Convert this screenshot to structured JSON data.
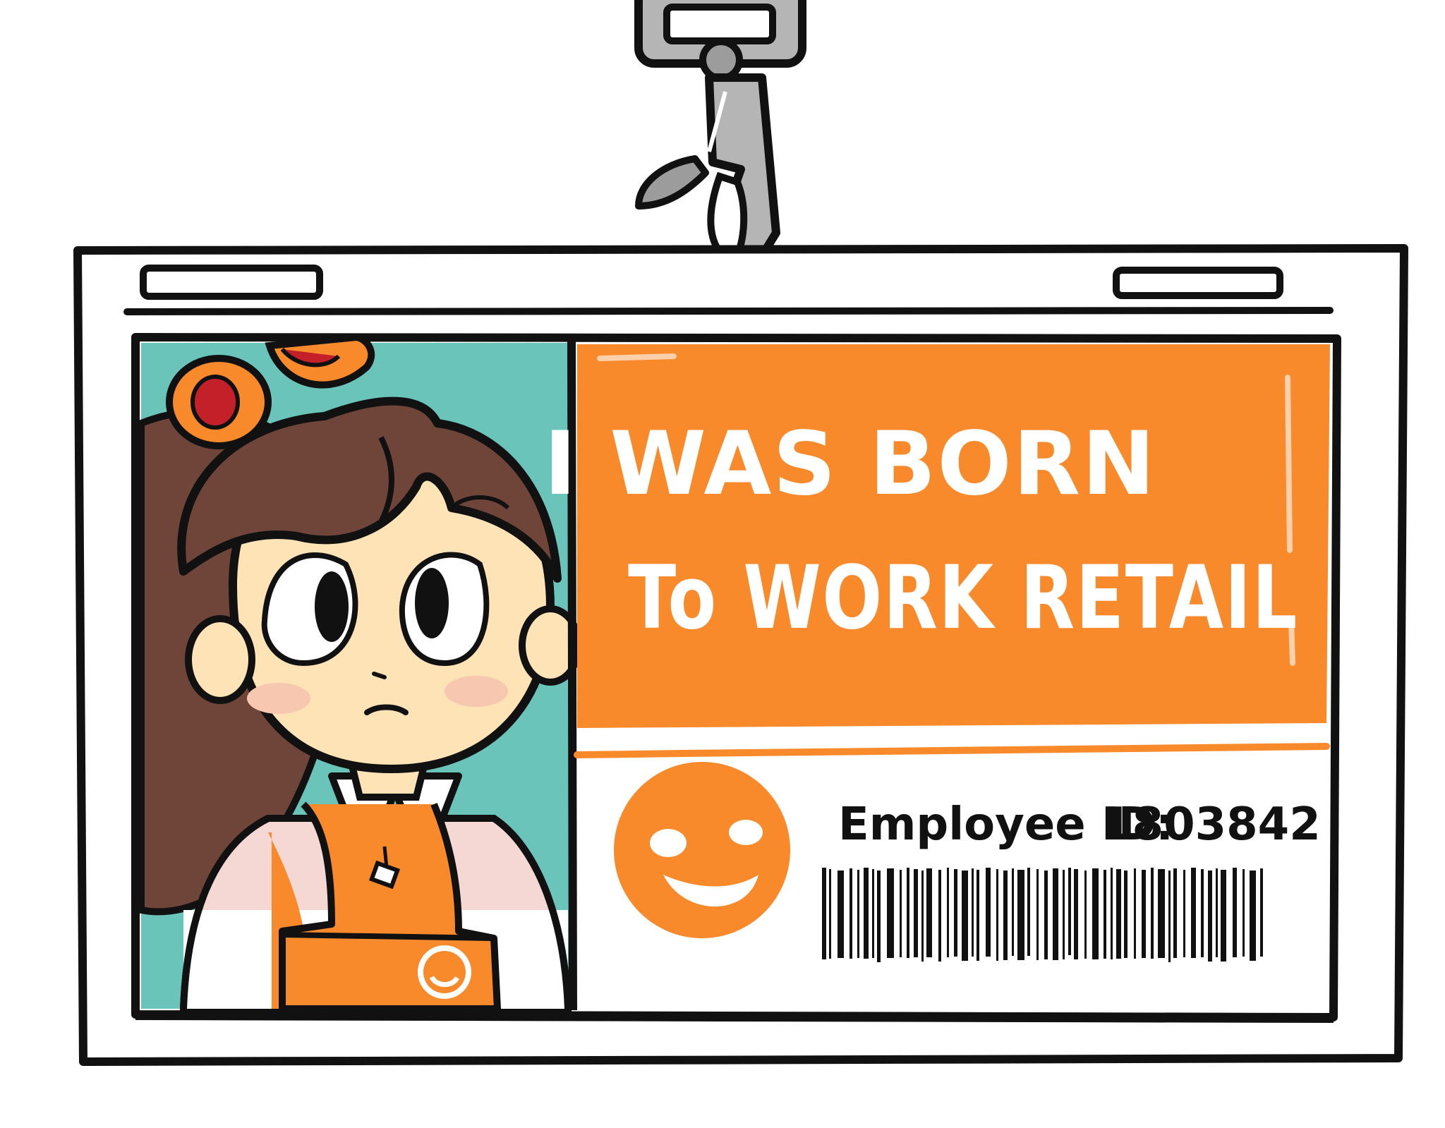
{
  "badge": {
    "headline_line1": "I WAS BORN",
    "headline_line2": "To WORK RETAIL",
    "employee_id_label": "Employee ID:",
    "employee_id_value": "1803842"
  },
  "colors": {
    "orange": "#f98a2c",
    "teal": "#6ac4ba",
    "outline": "#111111",
    "hair": "#6e4538",
    "skin": "#fde3b6",
    "shirt_pink": "#f5d7d3",
    "metal": "#b5b5b5"
  },
  "icons": {
    "logo": "smiley-face-icon",
    "clip": "lanyard-clip-icon"
  }
}
